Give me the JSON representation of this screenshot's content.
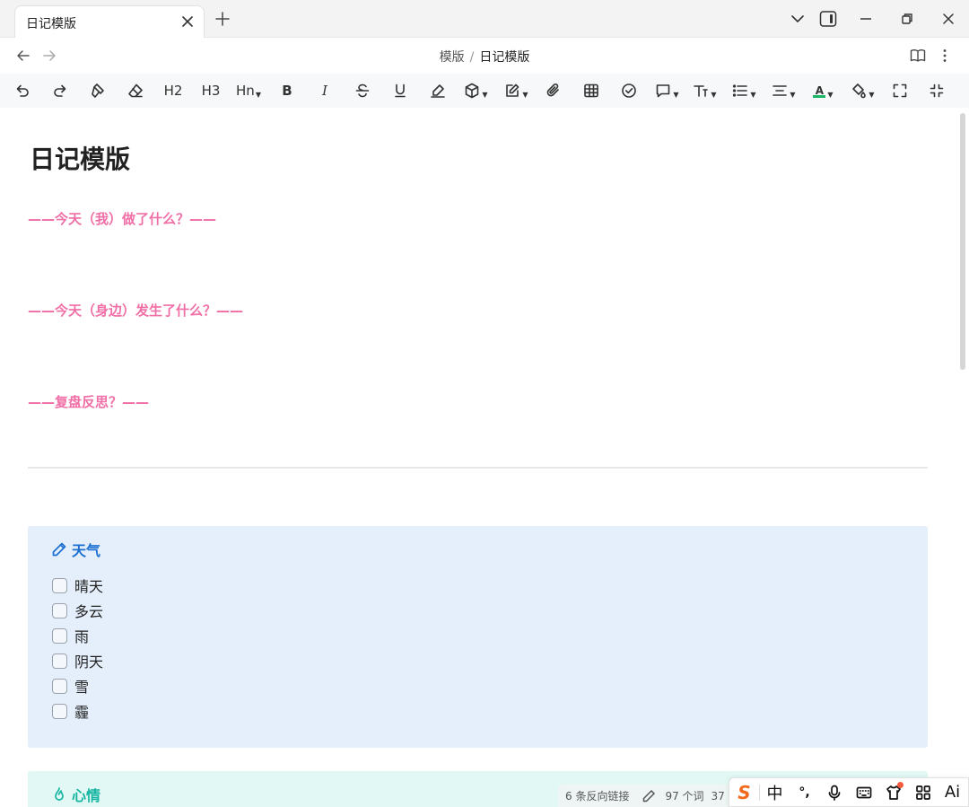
{
  "tab": {
    "title": "日记模版"
  },
  "breadcrumb": {
    "parent": "模版",
    "separator": "/",
    "current": "日记模版"
  },
  "toolbar": {
    "h2": "H2",
    "h3": "H3",
    "hn": "Hn",
    "bold": "B",
    "italic": "I",
    "font_color_letter": "A"
  },
  "document": {
    "title": "日记模版",
    "headings": [
      "——今天（我）做了什么？——",
      "——今天（身边）发生了什么？——",
      "——复盘反思？——"
    ],
    "weather": {
      "title": "天气",
      "accent": "#1b6fd0",
      "options": [
        "晴天",
        "多云",
        "雨",
        "阴天",
        "雪",
        "霾"
      ]
    },
    "mood": {
      "title": "心情",
      "accent": "#16b5a2"
    },
    "heading_color": "#f06fa6"
  },
  "statusbar": {
    "backlinks": "6 条反向链接",
    "words": "97 个词",
    "chars_partial": "37"
  },
  "ime": {
    "lang": "中",
    "punct": "°,",
    "ai": "Ai"
  }
}
